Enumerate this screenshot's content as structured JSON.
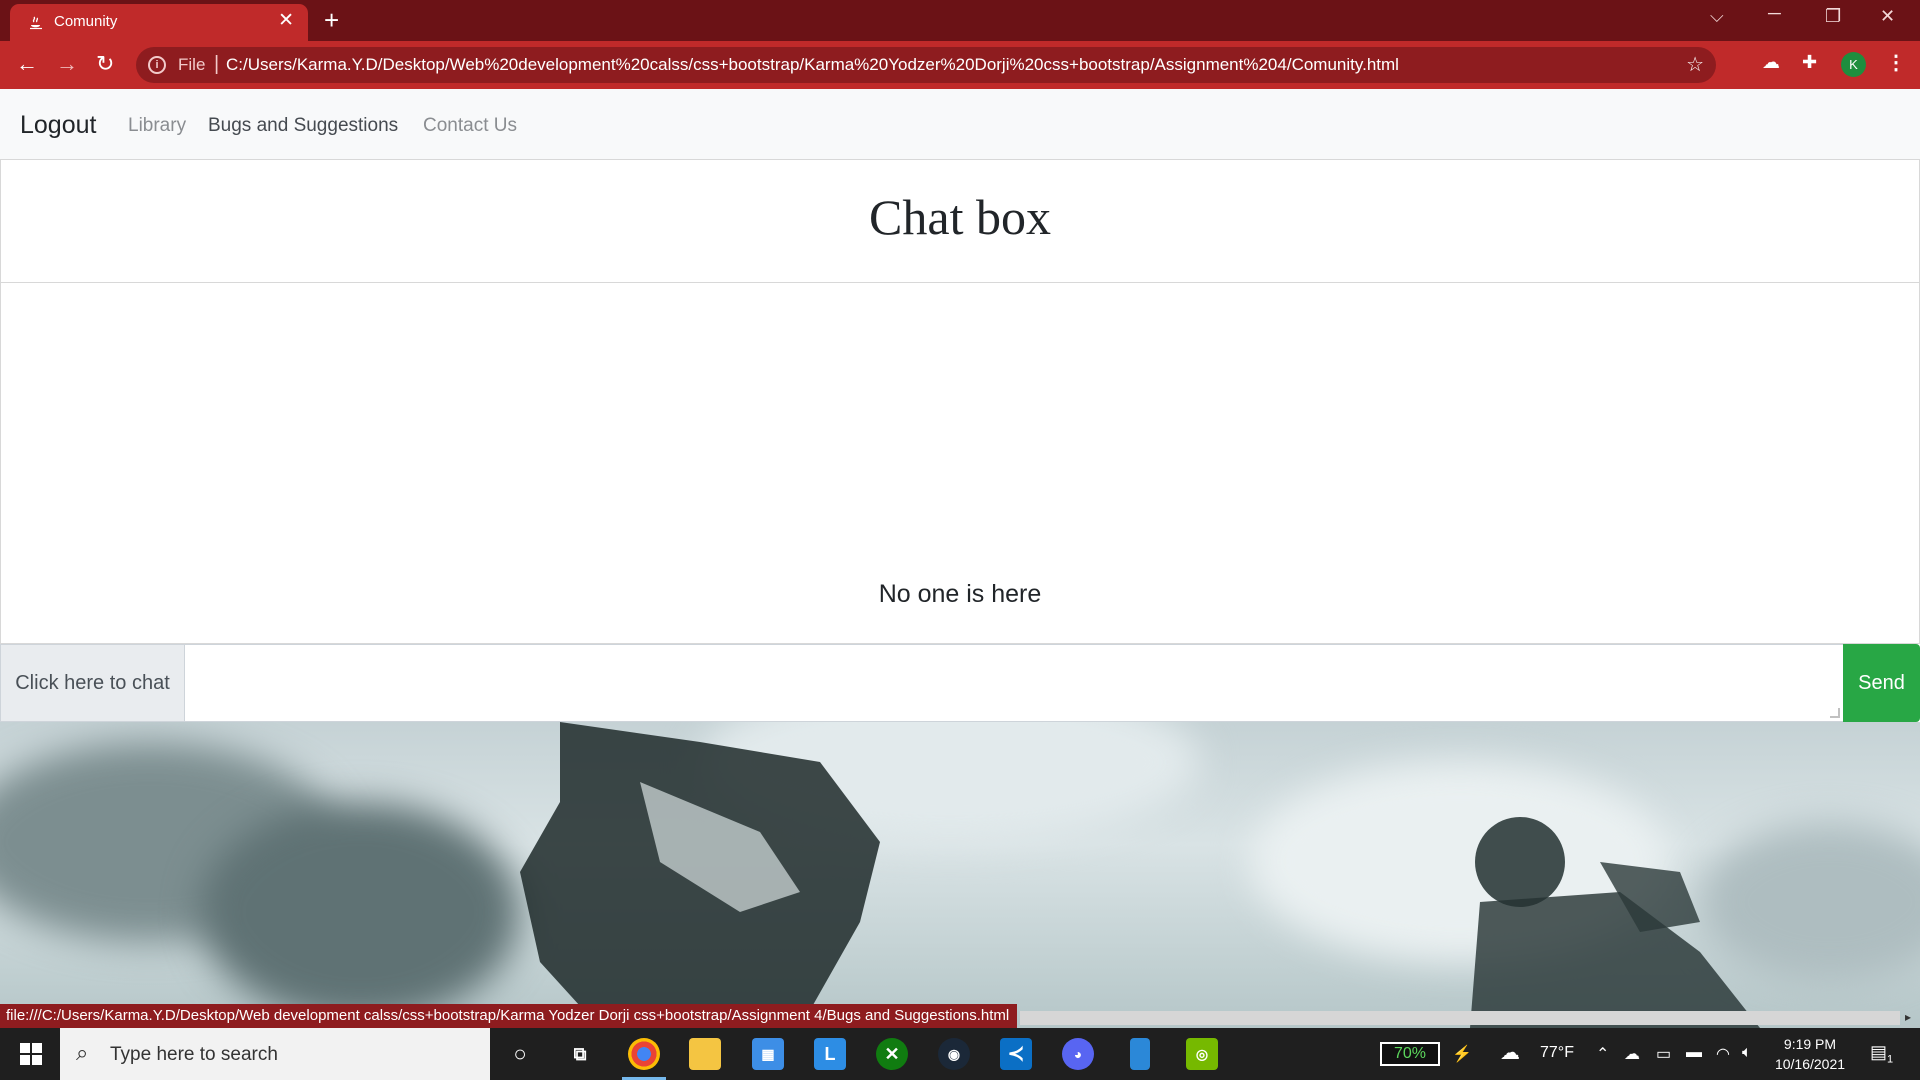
{
  "browser": {
    "tab_title": "Comunity",
    "tab_close": "✕",
    "new_tab": "+",
    "file_label": "File",
    "url": "C:/Users/Karma.Y.D/Desktop/Web%20development%20calss/css+bootstrap/Karma%20Yodzer%20Dorji%20css+bootstrap/Assignment%204/Comunity.html",
    "profile_initial": "K"
  },
  "navbar": {
    "brand": "Logout",
    "links": [
      "Library",
      "Bugs and Suggestions",
      "Contact Us"
    ]
  },
  "chat": {
    "title": "Chat box",
    "empty_message": "No one is here",
    "input_label": "Click here to chat",
    "send_label": "Send"
  },
  "status_bar": {
    "hover_url": "file:///C:/Users/Karma.Y.D/Desktop/Web development calss/css+bootstrap/Karma Yodzer Dorji css+bootstrap/Assignment 4/Bugs and Suggestions.html"
  },
  "taskbar": {
    "search_placeholder": "Type here to search",
    "battery": "70%",
    "temperature": "77°F",
    "time": "9:19 PM",
    "date": "10/16/2021",
    "notification_count": "1",
    "accent_color": "#c02a2a"
  }
}
